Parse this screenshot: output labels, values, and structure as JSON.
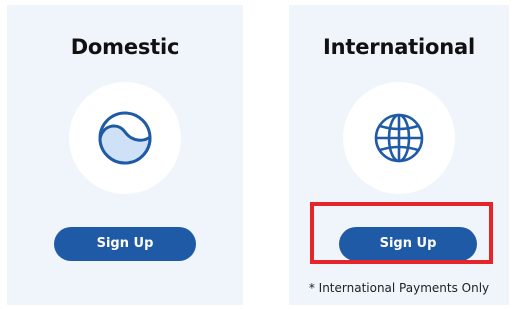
{
  "cards": [
    {
      "title": "Domestic",
      "icon": "half-filled-circle-icon",
      "button_label": "Sign Up",
      "note": ""
    },
    {
      "title": "International",
      "icon": "globe-icon",
      "button_label": "Sign Up",
      "note": "* International Payments Only"
    }
  ],
  "colors": {
    "card_background": "#eff5fa",
    "button": "#1f5aa6",
    "icon_stroke": "#1f5aa6",
    "icon_fill": "#cfe1f6",
    "highlight": "#e4262b"
  }
}
